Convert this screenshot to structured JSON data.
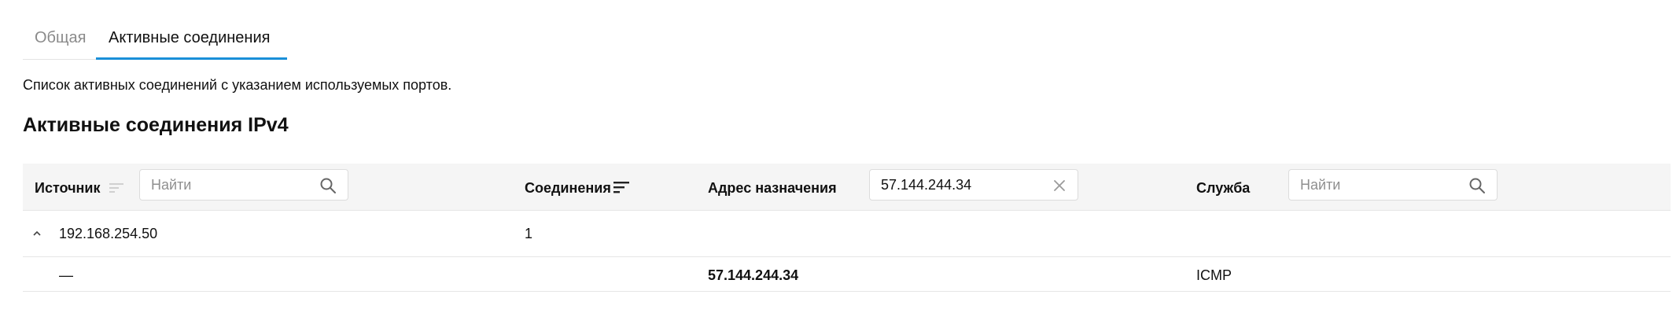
{
  "tabs": [
    {
      "label": "Общая",
      "active": false
    },
    {
      "label": "Активные соединения",
      "active": true
    }
  ],
  "accent_color": "#1a8fd8",
  "description": "Список активных соединений с указанием используемых портов.",
  "section_title": "Активные соединения IPv4",
  "table": {
    "columns": {
      "source": {
        "label": "Источник",
        "filter_placeholder": "Найти",
        "filter_value": "",
        "filter_icon": "search-icon",
        "sort_icon": "sort-inactive-icon"
      },
      "connections": {
        "label": "Соединения",
        "sort_icon": "sort-descending-icon"
      },
      "destination": {
        "label": "Адрес назначения",
        "filter_placeholder": "Найти",
        "filter_value": "57.144.244.34",
        "filter_icon": "clear-icon"
      },
      "service": {
        "label": "Служба",
        "filter_placeholder": "Найти",
        "filter_value": "",
        "filter_icon": "search-icon"
      }
    },
    "groups": [
      {
        "source": "192.168.254.50",
        "connections": "1",
        "expanded": true,
        "children": [
          {
            "source": "—",
            "destination": "57.144.244.34",
            "service": "ICMP"
          }
        ]
      }
    ]
  }
}
